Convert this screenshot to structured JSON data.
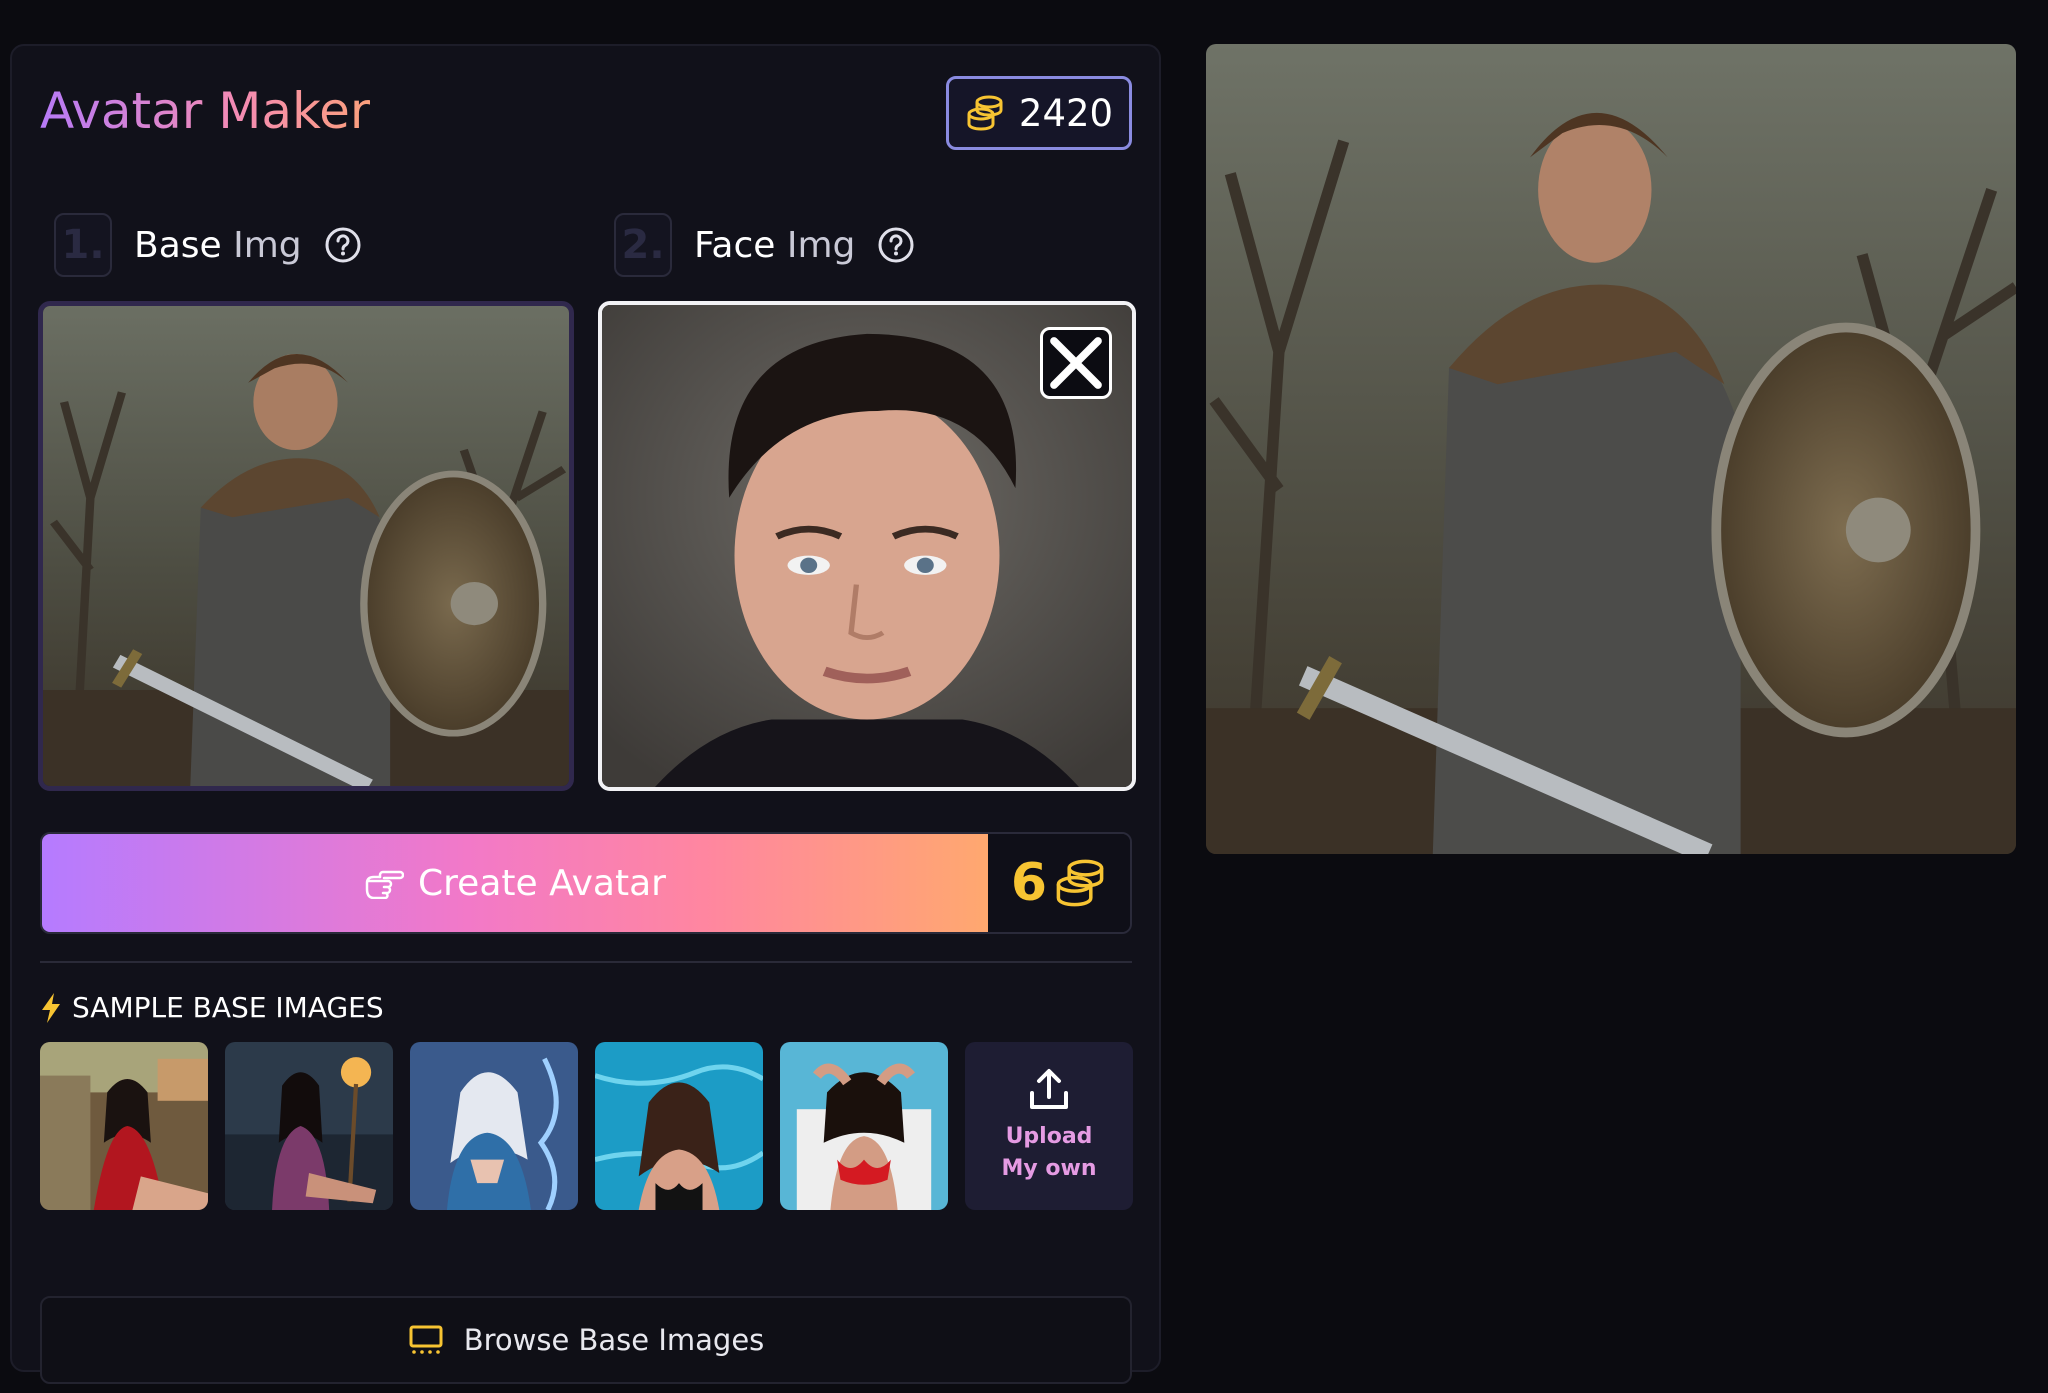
{
  "header": {
    "title": "Avatar Maker",
    "credits": "2420"
  },
  "steps": [
    {
      "number": "1.",
      "label_main": "Base",
      "label_soft": "Img"
    },
    {
      "number": "2.",
      "label_main": "Face",
      "label_soft": "Img"
    }
  ],
  "base_image": {
    "description_icon": "warrior-image"
  },
  "face_image": {
    "description_icon": "portrait-image"
  },
  "create": {
    "label": "Create Avatar",
    "cost": "6"
  },
  "samples": {
    "heading": "SAMPLE BASE IMAGES",
    "thumbnails": [
      "sample-1",
      "sample-2",
      "sample-3",
      "sample-4",
      "sample-5"
    ],
    "upload_label": "Upload My own"
  },
  "browse": {
    "label": "Browse Base Images"
  },
  "colors": {
    "accent_start": "#b57bff",
    "accent_end": "#ffa86f",
    "coin": "#f7c432",
    "background": "#0b0b10",
    "panel": "#11111a"
  }
}
